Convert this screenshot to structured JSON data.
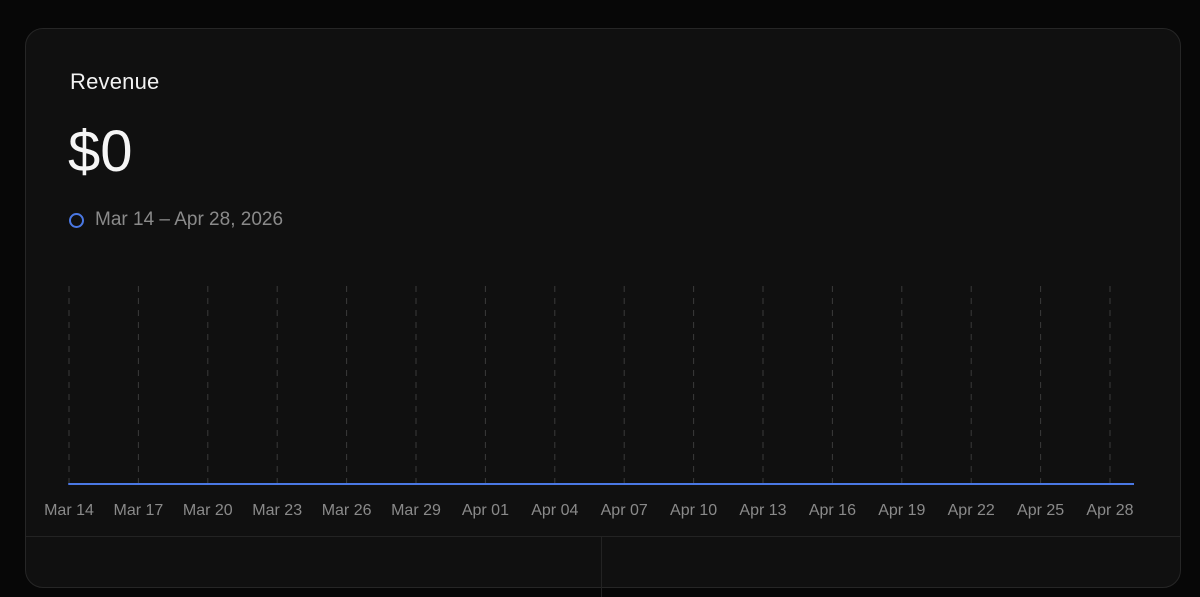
{
  "card": {
    "title": "Revenue",
    "amount": "$0",
    "legend_label": "Mar 14 – Apr 28, 2026"
  },
  "colors": {
    "series": "#4a78e4",
    "background": "#101010",
    "muted_text": "#8a8a8a"
  },
  "chart_data": {
    "type": "line",
    "categories": [
      "Mar 14",
      "Mar 17",
      "Mar 20",
      "Mar 23",
      "Mar 26",
      "Mar 29",
      "Apr 01",
      "Apr 04",
      "Apr 07",
      "Apr 10",
      "Apr 13",
      "Apr 16",
      "Apr 19",
      "Apr 22",
      "Apr 25",
      "Apr 28"
    ],
    "series": [
      {
        "name": "Mar 14 – Apr 28, 2026",
        "values": [
          0,
          0,
          0,
          0,
          0,
          0,
          0,
          0,
          0,
          0,
          0,
          0,
          0,
          0,
          0,
          0
        ]
      }
    ],
    "grid": "vertical dashed",
    "legend": "top-left"
  }
}
